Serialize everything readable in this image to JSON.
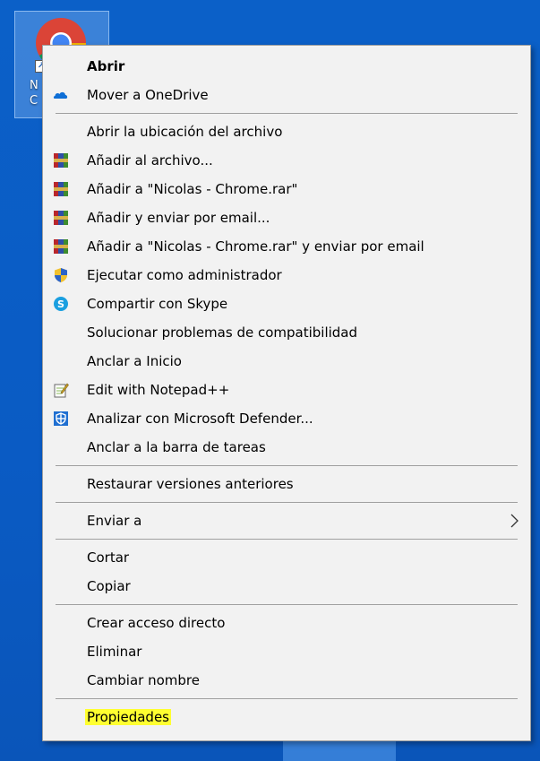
{
  "desktop": {
    "shortcut_label_line1": "N",
    "shortcut_label_line2": "C"
  },
  "menu": {
    "group1": [
      {
        "label": "Abrir",
        "icon": "none"
      },
      {
        "label": "Mover a OneDrive",
        "icon": "onedrive-icon"
      }
    ],
    "group2": [
      {
        "label": "Abrir la ubicación del archivo",
        "icon": "none"
      },
      {
        "label": "Añadir al archivo...",
        "icon": "winrar-icon"
      },
      {
        "label": "Añadir a \"Nicolas - Chrome.rar\"",
        "icon": "winrar-icon"
      },
      {
        "label": "Añadir y enviar por email...",
        "icon": "winrar-icon"
      },
      {
        "label": "Añadir a \"Nicolas - Chrome.rar\" y enviar por email",
        "icon": "winrar-icon"
      },
      {
        "label": "Ejecutar como administrador",
        "icon": "uac-shield-icon"
      },
      {
        "label": "Compartir con Skype",
        "icon": "skype-icon"
      },
      {
        "label": "Solucionar problemas de compatibilidad",
        "icon": "none"
      },
      {
        "label": "Anclar a Inicio",
        "icon": "none"
      },
      {
        "label": "Edit with Notepad++",
        "icon": "notepad-plus-plus-icon"
      },
      {
        "label": "Analizar con Microsoft Defender...",
        "icon": "defender-icon"
      },
      {
        "label": "Anclar a la barra de tareas",
        "icon": "none"
      }
    ],
    "group3": [
      {
        "label": "Restaurar versiones anteriores",
        "icon": "none"
      }
    ],
    "group4": [
      {
        "label": "Enviar a",
        "icon": "none"
      }
    ],
    "group5": [
      {
        "label": "Cortar",
        "icon": "none"
      },
      {
        "label": "Copiar",
        "icon": "none"
      }
    ],
    "group6": [
      {
        "label": "Crear acceso directo",
        "icon": "none"
      },
      {
        "label": "Eliminar",
        "icon": "none"
      },
      {
        "label": "Cambiar nombre",
        "icon": "none"
      }
    ],
    "group7": [
      {
        "label": "Propiedades",
        "icon": "none"
      }
    ]
  },
  "colors": {
    "menu_background": "#f2f2f2",
    "highlight": "#ffff30",
    "desktop_blue": "#0b60c8"
  }
}
